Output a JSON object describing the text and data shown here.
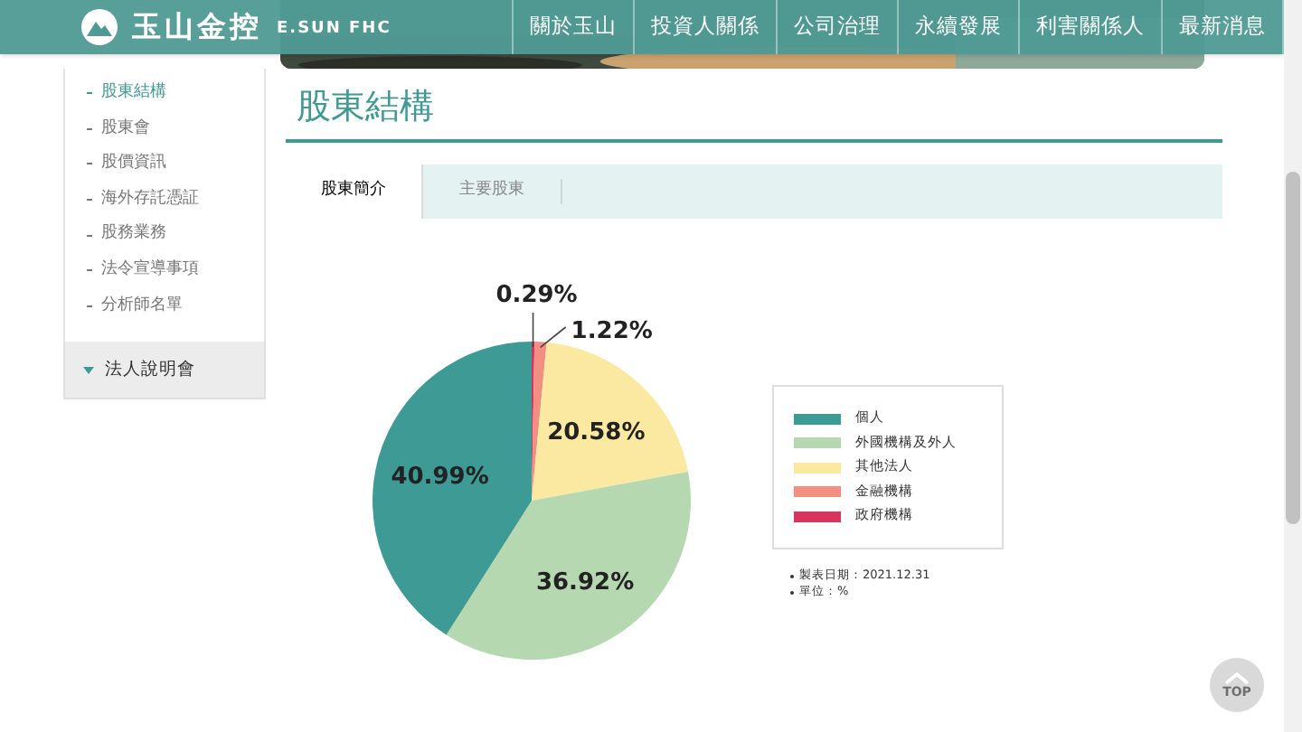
{
  "header": {
    "logo_text": "玉山金控",
    "logo_subtext": "E.SUN FHC",
    "nav": [
      {
        "label": "關於玉山"
      },
      {
        "label": "投資人關係"
      },
      {
        "label": "公司治理"
      },
      {
        "label": "永續發展"
      },
      {
        "label": "利害關係人"
      },
      {
        "label": "最新消息"
      }
    ]
  },
  "sidebar": {
    "items": [
      {
        "label": "股東結構",
        "selected": true
      },
      {
        "label": "股東會",
        "selected": false
      },
      {
        "label": "股價資訊",
        "selected": false
      },
      {
        "label": "海外存託憑証",
        "selected": false
      },
      {
        "label": "股務業務",
        "selected": false
      },
      {
        "label": "法令宣導事項",
        "selected": false
      },
      {
        "label": "分析師名單",
        "selected": false
      }
    ],
    "section": {
      "label": "法人說明會",
      "expanded": false
    }
  },
  "page_title": "股東結構",
  "tabs": [
    {
      "label": "股東簡介",
      "selected": true
    },
    {
      "label": "主要股東",
      "selected": false
    }
  ],
  "chart_data": {
    "type": "pie",
    "categories": [
      "個人",
      "外國機構及外人",
      "其他法人",
      "金融機構",
      "政府機構"
    ],
    "series": [
      {
        "values": [
          40.99,
          36.92,
          20.58,
          1.22,
          0.29
        ]
      }
    ],
    "colors": [
      "#3e9a94",
      "#b5d8b0",
      "#fbe9a2",
      "#f28e82",
      "#d9345e"
    ],
    "value_labels": [
      "40.99%",
      "36.92%",
      "20.58%",
      "1.22%",
      "0.29%"
    ]
  },
  "notes": [
    "製表日期：2021.12.31",
    "單位：%"
  ],
  "top_button": {
    "label": "TOP"
  }
}
